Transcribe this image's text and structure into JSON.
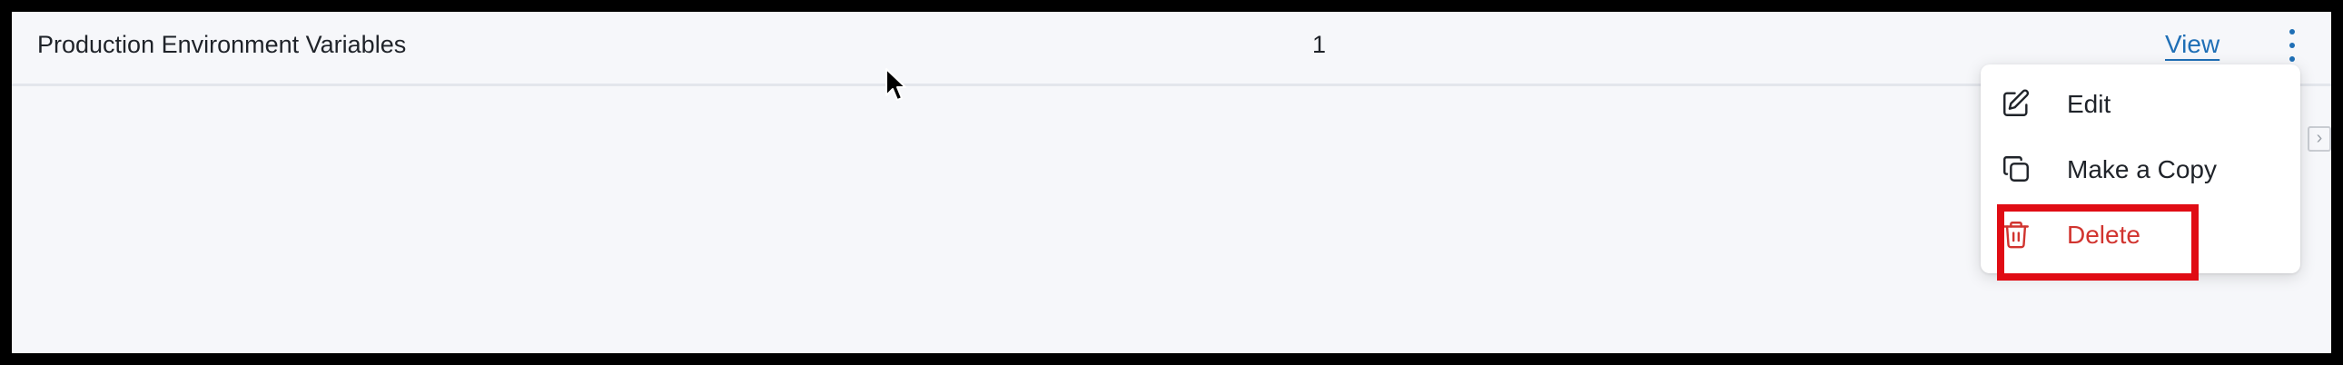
{
  "row": {
    "name": "Production Environment Variables",
    "count": "1",
    "view_label": "View",
    "more_actions_icon": "kebab-vertical-icon"
  },
  "menu": {
    "items": [
      {
        "label": "Edit",
        "icon": "pencil-edit-icon"
      },
      {
        "label": "Make a Copy",
        "icon": "copy-icon"
      },
      {
        "label": "Delete",
        "icon": "trash-icon"
      }
    ]
  },
  "scroll_arrow": {
    "glyph": "›",
    "icon": "chevron-right-icon"
  },
  "colors": {
    "background": "#f6f7fa",
    "text": "#1f2329",
    "link": "#1f6fb6",
    "danger": "#d1342f",
    "highlight": "#e00c14"
  }
}
